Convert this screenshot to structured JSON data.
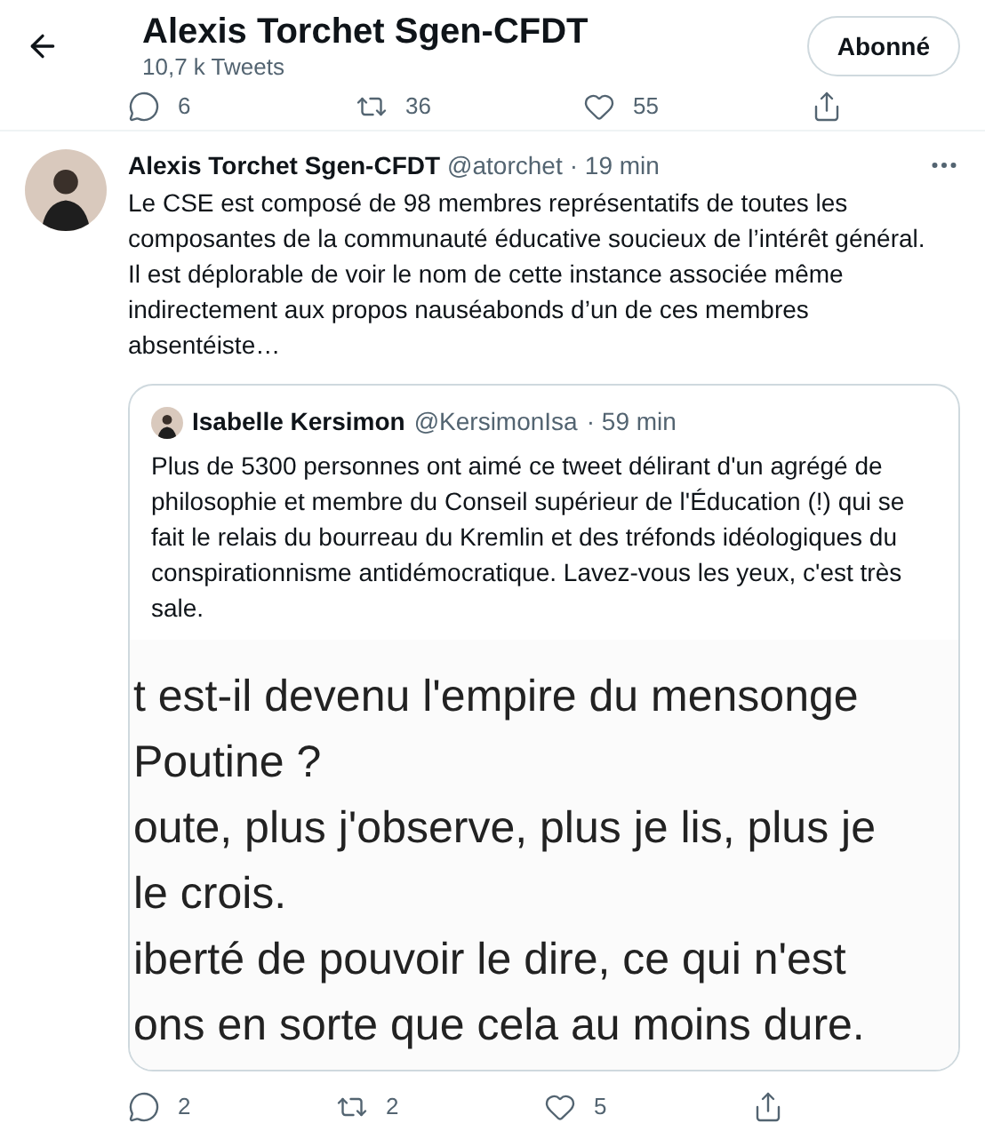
{
  "header": {
    "title": "Alexis Torchet Sgen-CFDT",
    "subtitle": "10,7 k Tweets",
    "follow_button": "Abonné"
  },
  "previous_actions": [
    {
      "kind": "reply",
      "count": "6"
    },
    {
      "kind": "retweet",
      "count": "36"
    },
    {
      "kind": "like",
      "count": "55"
    },
    {
      "kind": "share"
    }
  ],
  "tweet": {
    "author": "Alexis Torchet Sgen-CFDT",
    "handle": "@atorchet",
    "time": "· 19 min",
    "text": "Le CSE est composé de 98 membres représentatifs de toutes les composantes de la communauté éducative soucieux de l’intérêt général. Il est déplorable de voir le nom de cette instance associée même indirectement aux propos nauséabonds d’un de ces membres absentéiste…",
    "quote": {
      "author": "Isabelle Kersimon",
      "handle": "@KersimonIsa",
      "time": "· 59 min",
      "text": "Plus de 5300 personnes ont aimé ce tweet délirant d'un agrégé de philosophie et membre du Conseil supérieur de l'Éducation (!) qui se fait le relais du bourreau du Kremlin et des tréfonds idéologiques du conspirationnisme antidémocratique. Lavez-vous les yeux, c'est très sale.",
      "image_lines": [
        "t est-il devenu l'empire du mensonge",
        "Poutine ?",
        "oute, plus j'observe, plus je lis, plus je",
        "le crois.",
        "iberté de pouvoir le dire, ce qui n'est",
        "ons en sorte que cela au moins dure."
      ]
    },
    "actions": [
      {
        "kind": "reply",
        "count": "2"
      },
      {
        "kind": "retweet",
        "count": "2"
      },
      {
        "kind": "like",
        "count": "5"
      },
      {
        "kind": "share"
      }
    ]
  }
}
